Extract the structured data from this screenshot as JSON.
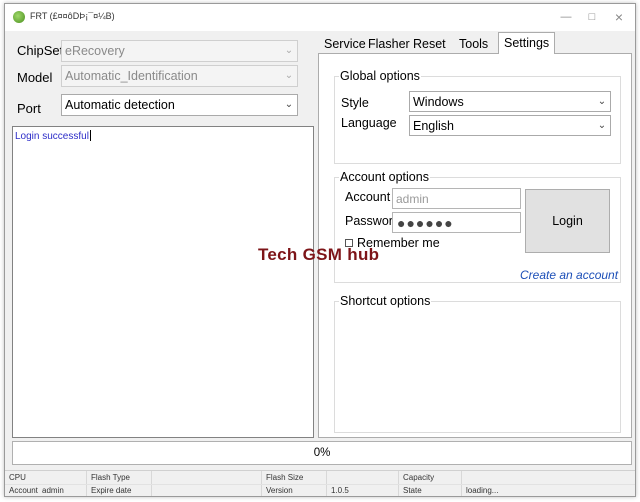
{
  "window": {
    "title": "FRT (£¤¤ôDÞ¡¯¤¼B)"
  },
  "left": {
    "chipset_label": "ChipSet",
    "chipset_value": "eRecovery",
    "model_label": "Model",
    "model_value": "Automatic_Identification",
    "port_label": "Port",
    "port_value": "Automatic detection",
    "log": [
      "Login successful"
    ]
  },
  "tabs": [
    {
      "label": "Service",
      "active": false
    },
    {
      "label": "Flasher",
      "active": false
    },
    {
      "label": "Reset",
      "active": false
    },
    {
      "label": "Tools",
      "active": false
    },
    {
      "label": "Settings",
      "active": true
    }
  ],
  "settings": {
    "global_title": "Global options",
    "style_label": "Style",
    "style_value": "Windows",
    "language_label": "Language",
    "language_value": "English",
    "account_title": "Account options",
    "account_label": "Account",
    "account_placeholder": "admin",
    "password_label": "Password",
    "password_mask": "●●●●●●",
    "login_button": "Login",
    "remember_label": "Remember me",
    "remember_checked": false,
    "create_link": "Create an account",
    "shortcut_title": "Shortcut options"
  },
  "overlay": {
    "watermark": "Tech GSM hub"
  },
  "progress": {
    "value": 0,
    "label": "0%"
  },
  "status": {
    "row1": {
      "cpu": "CPU",
      "flash_type": "Flash Type",
      "flash_size": "Flash Size",
      "capacity": "Capacity"
    },
    "row2": {
      "account_label": "Account",
      "account_value": "admin",
      "expire_label": "Expire date",
      "version_label": "Version",
      "version_value": "1.0.5",
      "state_label": "State",
      "state_value": "loading..."
    }
  },
  "colors": {
    "log_text": "#2d2dc8",
    "link": "#1c4fb8",
    "watermark": "#7d1418",
    "progress_fill": "#06b025"
  }
}
